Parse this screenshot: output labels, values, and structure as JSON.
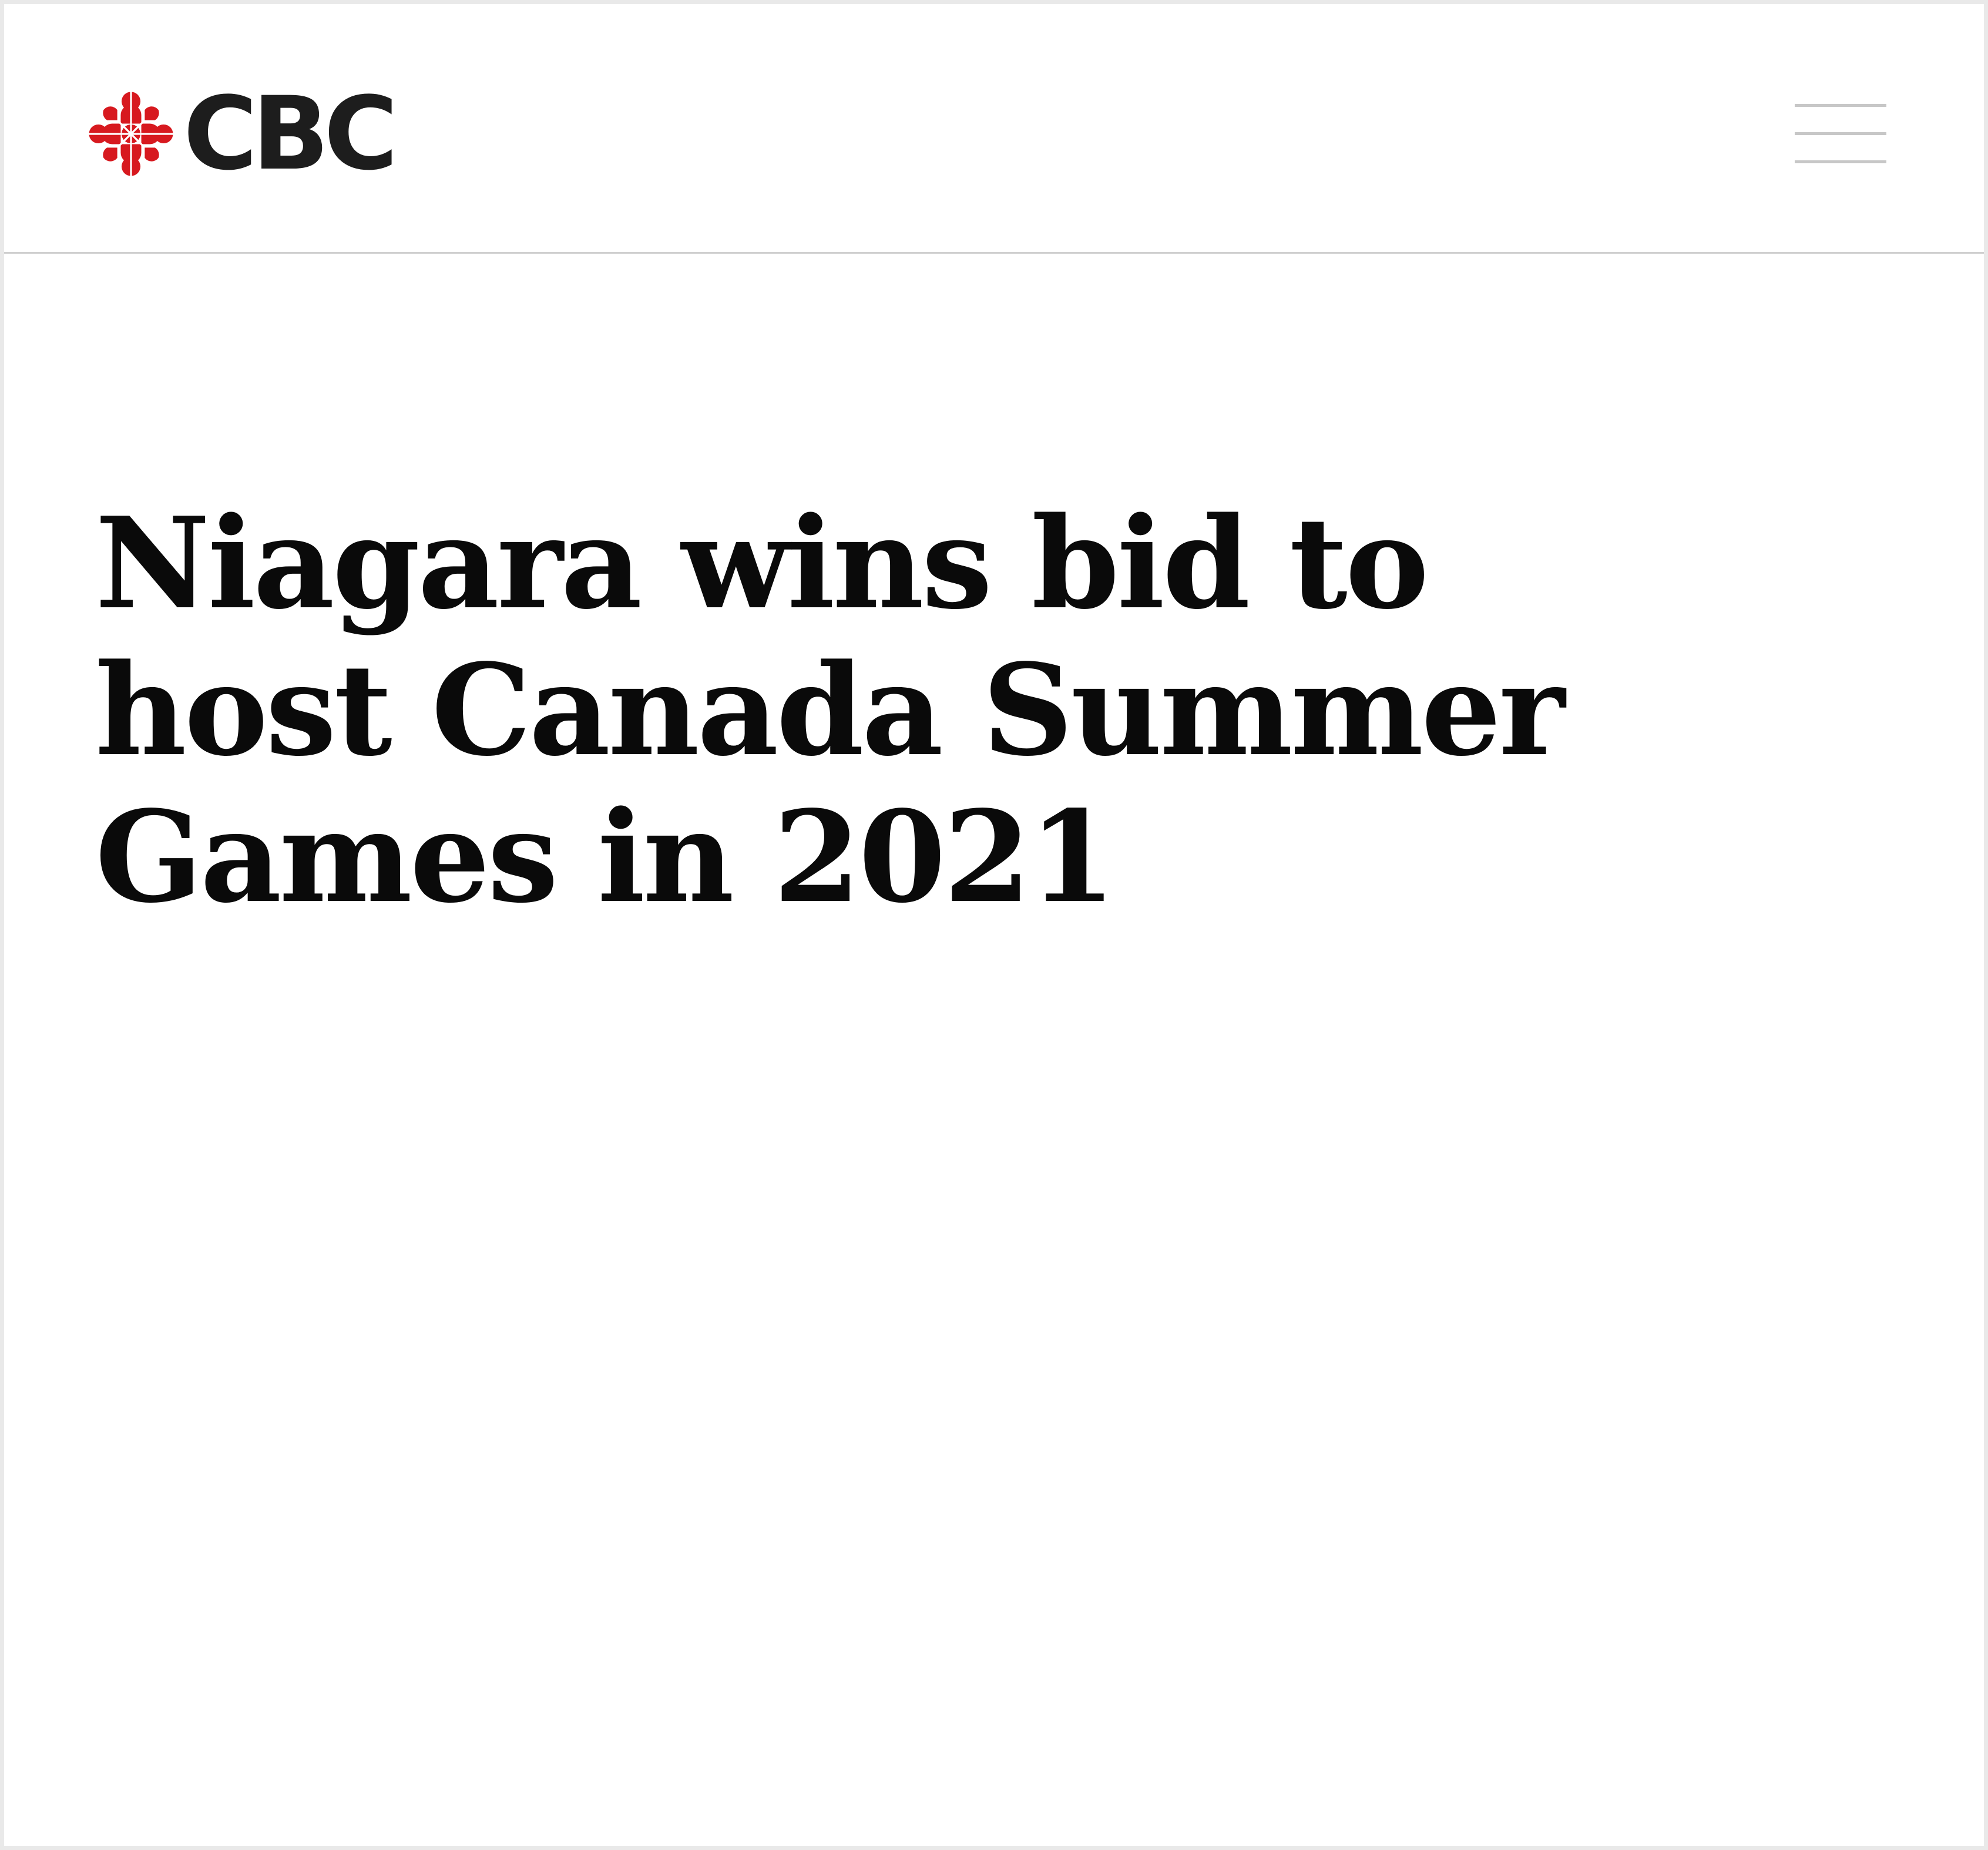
{
  "header": {
    "logo_wordmark": "CBC",
    "logo_icon": "cbc-gem-icon",
    "menu_icon": "hamburger-menu-icon",
    "brand_color": "#d7191f",
    "divider_color": "#cfcfcf"
  },
  "article": {
    "headline": "Niagara wins bid to host Canada Summer Games in 2021"
  }
}
